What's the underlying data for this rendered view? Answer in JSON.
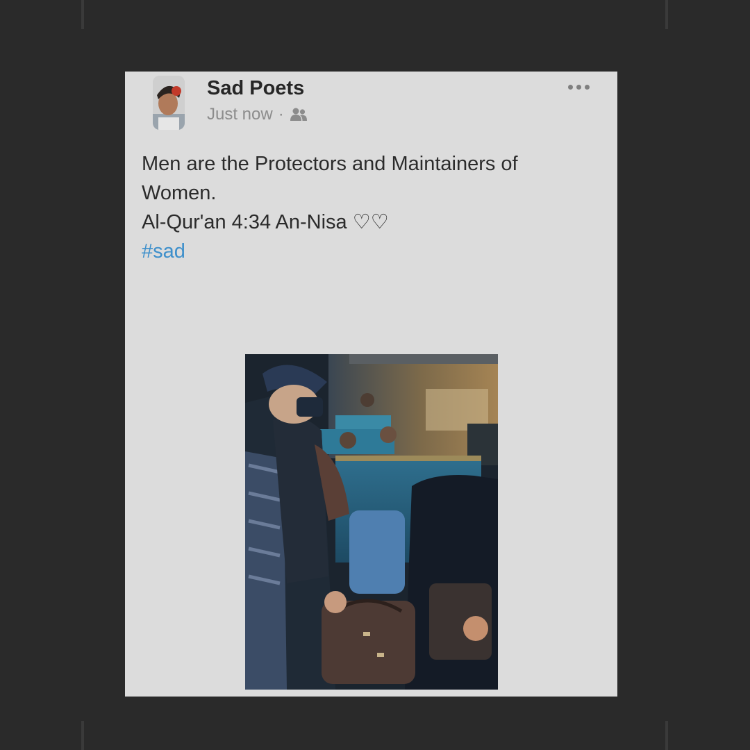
{
  "post": {
    "author": "Sad Poets",
    "timestamp": "Just now",
    "separator": "·",
    "audience_icon": "friends-icon",
    "more_icon": "more-options-icon",
    "text_lines": [
      "Men are the Protectors and Maintainers of Women.",
      "Al-Qur'an 4:34 An-Nisa ♡♡"
    ],
    "hashtag": "#sad"
  },
  "colors": {
    "page_background": "#2a2a2a",
    "card_background": "#dcdcdc",
    "author_text": "#262626",
    "meta_text": "#8c8c8c",
    "hashtag_link": "#3d8fcb"
  }
}
